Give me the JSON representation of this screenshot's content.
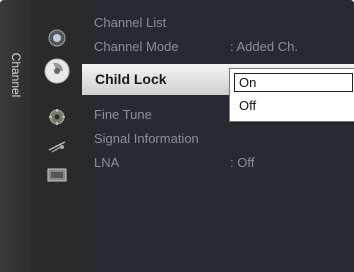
{
  "side_tab": {
    "label": "Channel"
  },
  "icons": [
    {
      "name": "picture-icon"
    },
    {
      "name": "sound-icon"
    },
    {
      "name": "setup-icon"
    },
    {
      "name": "antenna-icon"
    },
    {
      "name": "input-icon"
    }
  ],
  "menu": {
    "items": [
      {
        "label": "Channel List",
        "value": ""
      },
      {
        "label": "Channel Mode",
        "value": ": Added Ch."
      },
      {
        "label": "Child Lock",
        "value": ""
      },
      {
        "label": "Fine Tune",
        "value": ""
      },
      {
        "label": "Signal Information",
        "value": ""
      },
      {
        "label": "LNA",
        "value": ": Off"
      }
    ],
    "selected": "Child Lock"
  },
  "dropdown": {
    "options": [
      "On",
      "Off"
    ],
    "highlighted": "On"
  },
  "colors": {
    "menu_bg": "#262a31",
    "dim_text": "#8a8f98",
    "highlight_bar": "#e6e6e6"
  }
}
